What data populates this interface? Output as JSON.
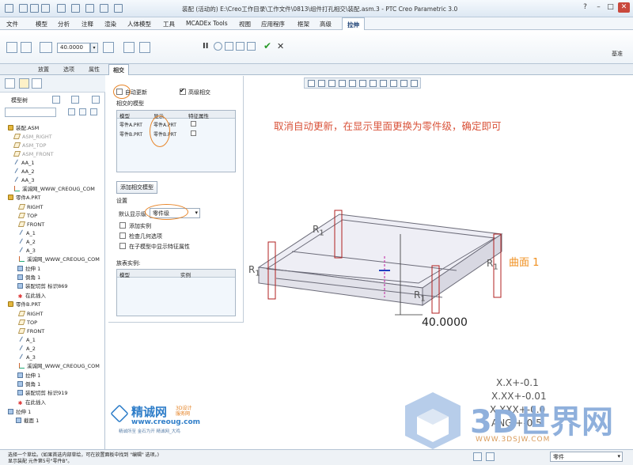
{
  "window": {
    "title": "装配 (活动的) E:\\Creo工作目录\\工作文件\\0813\\组件打孔相交\\装配.asm.3 - PTC Creo Parametric 3.0"
  },
  "menu": {
    "items": [
      "文件",
      "模型",
      "分析",
      "注释",
      "渲染",
      "人体模型",
      "工具",
      "MCADEx Tools",
      "视图",
      "应用程序",
      "框架",
      "高级",
      "拉伸"
    ],
    "active": "拉伸"
  },
  "ribbon": {
    "depth_value": "40.0000",
    "datum_label": "基准"
  },
  "dashboard_tabs": [
    "放置",
    "选项",
    "属性",
    "相交"
  ],
  "dashboard_active": "相交",
  "model_tree": {
    "title": "模型树",
    "items": [
      {
        "label": "装配.ASM",
        "icon": "assembly-icon",
        "dim": false
      },
      {
        "label": "ASM_RIGHT",
        "icon": "datum-plane-icon",
        "dim": true
      },
      {
        "label": "ASM_TOP",
        "icon": "datum-plane-icon",
        "dim": true
      },
      {
        "label": "ASM_FRONT",
        "icon": "datum-plane-icon",
        "dim": true
      },
      {
        "label": "AA_1",
        "icon": "axis-icon",
        "dim": false
      },
      {
        "label": "AA_2",
        "icon": "axis-icon",
        "dim": false
      },
      {
        "label": "AA_3",
        "icon": "axis-icon",
        "dim": false
      },
      {
        "label": "溪诚网_WWW_CREOUG_COM",
        "icon": "csys-icon",
        "dim": false
      },
      {
        "label": "零件A.PRT",
        "icon": "part-icon",
        "dim": false
      },
      {
        "label": "RIGHT",
        "icon": "datum-plane-icon",
        "dim": false
      },
      {
        "label": "TOP",
        "icon": "datum-plane-icon",
        "dim": false
      },
      {
        "label": "FRONT",
        "icon": "datum-plane-icon",
        "dim": false
      },
      {
        "label": "A_1",
        "icon": "axis-icon",
        "dim": false
      },
      {
        "label": "A_2",
        "icon": "axis-icon",
        "dim": false
      },
      {
        "label": "A_3",
        "icon": "axis-icon",
        "dim": false
      },
      {
        "label": "溪诚网_WWW_CREOUG_COM",
        "icon": "csys-icon",
        "dim": false
      },
      {
        "label": "拉伸 1",
        "icon": "feature-icon",
        "dim": false
      },
      {
        "label": "倒角 1",
        "icon": "feature-icon",
        "dim": false
      },
      {
        "label": "装配切剪 标识869",
        "icon": "feature-icon",
        "dim": false
      },
      {
        "label": "在此插入",
        "icon": "insert-icon",
        "dim": false
      },
      {
        "label": "零件B.PRT",
        "icon": "part-icon",
        "dim": false
      },
      {
        "label": "RIGHT",
        "icon": "datum-plane-icon",
        "dim": false
      },
      {
        "label": "TOP",
        "icon": "datum-plane-icon",
        "dim": false
      },
      {
        "label": "FRONT",
        "icon": "datum-plane-icon",
        "dim": false
      },
      {
        "label": "A_1",
        "icon": "axis-icon",
        "dim": false
      },
      {
        "label": "A_2",
        "icon": "axis-icon",
        "dim": false
      },
      {
        "label": "A_3",
        "icon": "axis-icon",
        "dim": false
      },
      {
        "label": "溪诚网_WWW_CREOUG_COM",
        "icon": "csys-icon",
        "dim": false
      },
      {
        "label": "拉伸 1",
        "icon": "feature-icon",
        "dim": false
      },
      {
        "label": "倒角 1",
        "icon": "feature-icon",
        "dim": false
      },
      {
        "label": "装配切剪 标识919",
        "icon": "feature-icon",
        "dim": false
      },
      {
        "label": "在此插入",
        "icon": "insert-icon",
        "dim": false
      },
      {
        "label": "拉伸 1",
        "icon": "feature-icon",
        "dim": false
      },
      {
        "label": "截面 1",
        "icon": "sketch-icon",
        "dim": false
      }
    ]
  },
  "intersect_panel": {
    "auto_update_label": "自动更新",
    "auto_update_checked": false,
    "advanced_label": "高级相交",
    "advanced_checked": true,
    "intersected_models_label": "相交的模型",
    "table_headers": [
      "模型",
      "显示",
      "特征属性"
    ],
    "table_rows": [
      {
        "model": "零件A.PRT",
        "display": "零件A.PRT"
      },
      {
        "model": "零件B.PRT",
        "display": "零件B.PRT"
      }
    ],
    "add_button": "添加相交模型",
    "settings_label": "设置",
    "default_display_label": "默认显示级",
    "default_display_value": "零件级",
    "options": [
      "添加实例",
      "检查几何选项",
      "在子模型中显示特征属性"
    ],
    "instance_label": "族表实例:",
    "instance_headers": [
      "模型",
      "实例"
    ]
  },
  "viewport": {
    "annotation": "取消自动更新，在显示里面更换为零件级，确定即可",
    "surface_label": "曲面 1",
    "dimension_value": "40.0000",
    "radius_label": "R",
    "radius_sub": "1",
    "tolerances": [
      "X.X+-0.1",
      "X.XX+-0.01",
      "X.XXX+-0.0",
      "ANG.+-0.5"
    ],
    "watermark_big": "3D世界网",
    "watermark_url": "WWW.3DSJW.COM",
    "logo_text": "精诚网",
    "logo_sub": "3D设计 服务网",
    "logo_url": "www.creoug.com",
    "logo_slogan": "精诚所至 金石为开 精诚网_大鸡"
  },
  "status": {
    "lines": [
      "选择一个草绘。(如果首选内部草绘，可在放置面板中找到 \"编辑\" 选项。)",
      "显示装配 元件第5号\"零件B\"。"
    ],
    "filter_value": "零件"
  },
  "colors": {
    "annotation": "#d9533a",
    "highlight": "#e8862a",
    "accent": "#1a3f73"
  }
}
